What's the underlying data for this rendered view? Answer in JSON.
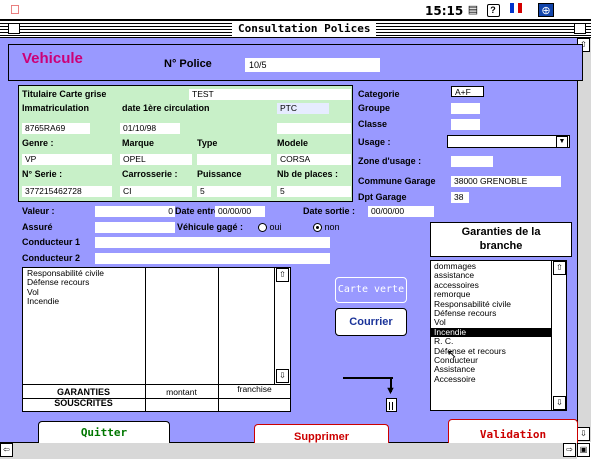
{
  "menubar": {
    "clock": "15:15"
  },
  "window": {
    "title": "Consultation Polices"
  },
  "header": {
    "section_title": "Vehicule",
    "police_label": "N° Police",
    "police_value": "10/5"
  },
  "vehicle": {
    "titulaire_label": "Titulaire Carte grise",
    "titulaire_value": "TEST",
    "immatriculation_label": "Immatriculation",
    "date_circ_label": "date 1ère circulation",
    "ptc_label": "PTC",
    "immatriculation_value": "8765RA69",
    "date_circ_value": "01/10/98",
    "genre_label": "Genre :",
    "marque_label": "Marque",
    "type_label": "Type",
    "modele_label": "Modele",
    "genre_value": "VP",
    "marque_value": "OPEL",
    "modele_value": "CORSA",
    "serie_label": "N° Serie :",
    "carrosserie_label": "Carrosserie :",
    "puissance_label": "Puissance",
    "places_label": "Nb de places :",
    "serie_value": "377215462728",
    "carrosserie_value": "CI",
    "puissance_value": "5",
    "places_value": "5"
  },
  "right_fields": {
    "categorie_label": "Categorie",
    "categorie_value": "A+F",
    "groupe_label": "Groupe",
    "classe_label": "Classe",
    "usage_label": "Usage :",
    "zone_label": "Zone d'usage :",
    "commune_label": "Commune Garage",
    "commune_value": "38000 GRENOBLE",
    "dpt_label": "Dpt Garage",
    "dpt_value": "38"
  },
  "contract": {
    "valeur_label": "Valeur :",
    "valeur_value": "0",
    "date_entree_label": "Date entrée :",
    "date_entree_value": "00/00/00",
    "date_sortie_label": "Date sortie :",
    "date_sortie_value": "00/00/00",
    "assure_label": "Assuré",
    "gage_label": "Véhicule gagé :",
    "gage_options": [
      "oui",
      "non"
    ],
    "gage_selected": "non",
    "conducteur1_label": "Conducteur 1",
    "conducteur2_label": "Conducteur 2"
  },
  "garanties_souscrites": {
    "items": [
      "Responsabilité civile",
      "Défense recours",
      "Vol",
      "Incendie"
    ],
    "footer_label_1": "GARANTIES",
    "footer_label_2": "SOUSCRITES",
    "montant_label": "montant",
    "franchise_label": "franchise"
  },
  "garanties_branche": {
    "title_1": "Garanties de la",
    "title_2": "branche",
    "items": [
      "dommages",
      "assistance",
      "accessoires",
      "remorque",
      "Responsabilité civile",
      "Défense recours",
      "Vol",
      "Incendie",
      "R. C.",
      "Défense et recours",
      "Conducteur",
      "Assistance",
      "Accessoire"
    ],
    "selected_index": 7
  },
  "buttons": {
    "carte_verte": "Carte verte",
    "courrier": "Courrier",
    "quitter": "Quitter",
    "supprimer": "Supprimer",
    "validation": "Validation"
  },
  "colors": {
    "background": "#9999ff",
    "green_panel": "#c8f0c8",
    "title_accent": "#cc0077",
    "quitter": "#007700",
    "danger": "#cc0000"
  }
}
